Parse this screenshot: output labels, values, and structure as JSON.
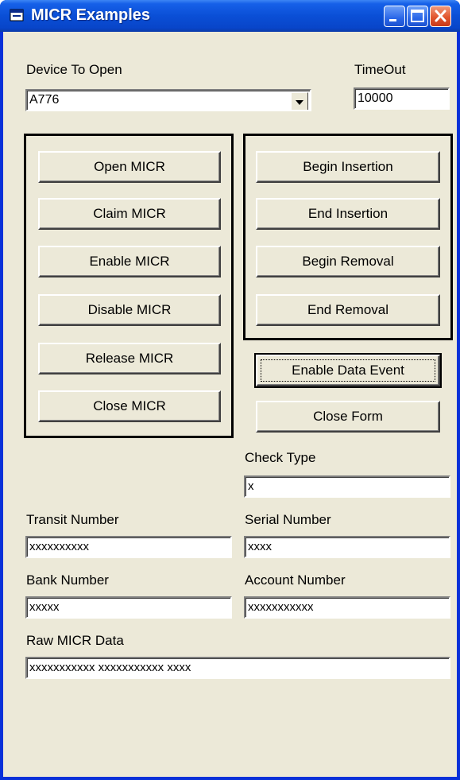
{
  "window": {
    "title": "MICR Examples"
  },
  "device": {
    "label": "Device To Open",
    "value": "A776"
  },
  "timeout": {
    "label": "TimeOut",
    "value": "10000"
  },
  "left_buttons": [
    "Open MICR",
    "Claim MICR",
    "Enable MICR",
    "Disable MICR",
    "Release MICR",
    "Close MICR"
  ],
  "right_buttons": [
    "Begin Insertion",
    "End Insertion",
    "Begin Removal",
    "End Removal"
  ],
  "enable_data_event": "Enable Data Event",
  "close_form": "Close Form",
  "check_type": {
    "label": "Check Type",
    "value": "x"
  },
  "transit_number": {
    "label": "Transit Number",
    "value": "xxxxxxxxxx"
  },
  "serial_number": {
    "label": "Serial Number",
    "value": "xxxx"
  },
  "bank_number": {
    "label": "Bank Number",
    "value": "xxxxx"
  },
  "account_number": {
    "label": "Account Number",
    "value": "xxxxxxxxxxx"
  },
  "raw_micr": {
    "label": "Raw MICR Data",
    "value": "xxxxxxxxxxx xxxxxxxxxxx xxxx"
  },
  "icons": {
    "app": "app-window-icon",
    "minimize": "minimize-icon",
    "maximize": "maximize-icon",
    "close": "close-icon",
    "dropdown": "chevron-down-icon"
  },
  "colors": {
    "titlebar": "#0a4fd6",
    "client": "#ece9d8",
    "close_button": "#e2562d"
  }
}
